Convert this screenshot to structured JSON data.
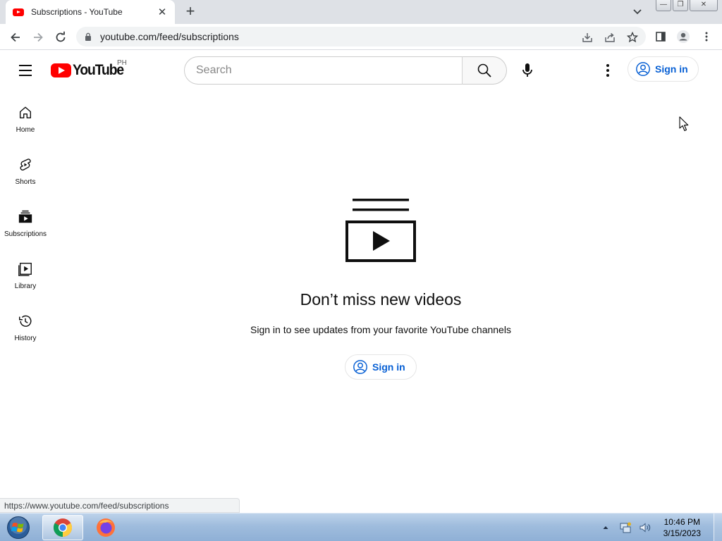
{
  "browser": {
    "tab_title": "Subscriptions - YouTube",
    "tab_close": "✕",
    "new_tab": "+",
    "url": "youtube.com/feed/subscriptions",
    "status_url": "https://www.youtube.com/feed/subscriptions"
  },
  "window_controls": {
    "minimize": "—",
    "restore": "❐",
    "close": "✕"
  },
  "masthead": {
    "logo_text": "YouTube",
    "country_code": "PH",
    "search_placeholder": "Search",
    "sign_in": "Sign in"
  },
  "guide": {
    "items": [
      {
        "label": "Home",
        "icon": "home-icon"
      },
      {
        "label": "Shorts",
        "icon": "shorts-icon"
      },
      {
        "label": "Subscriptions",
        "icon": "subscriptions-icon"
      },
      {
        "label": "Library",
        "icon": "library-icon"
      },
      {
        "label": "History",
        "icon": "history-icon"
      }
    ]
  },
  "empty_state": {
    "headline": "Don’t miss new videos",
    "subtext": "Sign in to see updates from your favorite YouTube channels",
    "sign_in": "Sign in"
  },
  "taskbar": {
    "apps": [
      {
        "name": "chrome",
        "active": true
      },
      {
        "name": "firefox",
        "active": false
      }
    ],
    "time": "10:46 PM",
    "date": "3/15/2023"
  },
  "colors": {
    "brand_red": "#ff0000",
    "link_blue": "#065fd4",
    "tab_strip": "#dee1e6"
  }
}
